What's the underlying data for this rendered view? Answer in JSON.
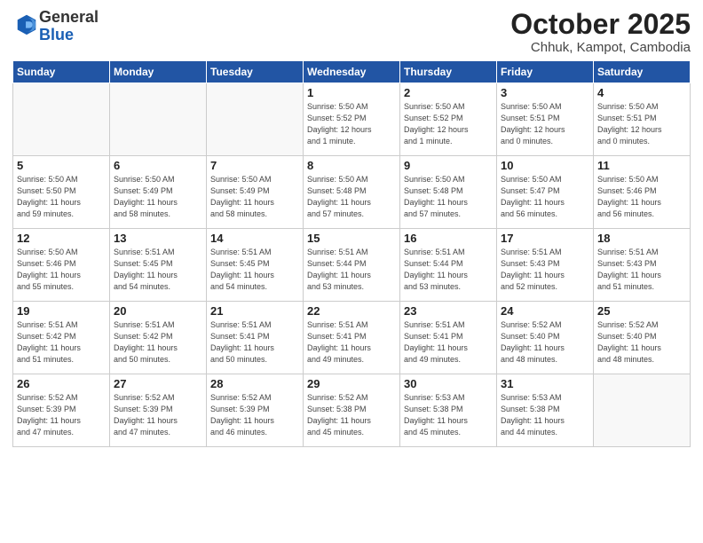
{
  "header": {
    "logo_general": "General",
    "logo_blue": "Blue",
    "month": "October 2025",
    "location": "Chhuk, Kampot, Cambodia"
  },
  "weekdays": [
    "Sunday",
    "Monday",
    "Tuesday",
    "Wednesday",
    "Thursday",
    "Friday",
    "Saturday"
  ],
  "weeks": [
    [
      {
        "day": "",
        "info": ""
      },
      {
        "day": "",
        "info": ""
      },
      {
        "day": "",
        "info": ""
      },
      {
        "day": "1",
        "info": "Sunrise: 5:50 AM\nSunset: 5:52 PM\nDaylight: 12 hours\nand 1 minute."
      },
      {
        "day": "2",
        "info": "Sunrise: 5:50 AM\nSunset: 5:52 PM\nDaylight: 12 hours\nand 1 minute."
      },
      {
        "day": "3",
        "info": "Sunrise: 5:50 AM\nSunset: 5:51 PM\nDaylight: 12 hours\nand 0 minutes."
      },
      {
        "day": "4",
        "info": "Sunrise: 5:50 AM\nSunset: 5:51 PM\nDaylight: 12 hours\nand 0 minutes."
      }
    ],
    [
      {
        "day": "5",
        "info": "Sunrise: 5:50 AM\nSunset: 5:50 PM\nDaylight: 11 hours\nand 59 minutes."
      },
      {
        "day": "6",
        "info": "Sunrise: 5:50 AM\nSunset: 5:49 PM\nDaylight: 11 hours\nand 58 minutes."
      },
      {
        "day": "7",
        "info": "Sunrise: 5:50 AM\nSunset: 5:49 PM\nDaylight: 11 hours\nand 58 minutes."
      },
      {
        "day": "8",
        "info": "Sunrise: 5:50 AM\nSunset: 5:48 PM\nDaylight: 11 hours\nand 57 minutes."
      },
      {
        "day": "9",
        "info": "Sunrise: 5:50 AM\nSunset: 5:48 PM\nDaylight: 11 hours\nand 57 minutes."
      },
      {
        "day": "10",
        "info": "Sunrise: 5:50 AM\nSunset: 5:47 PM\nDaylight: 11 hours\nand 56 minutes."
      },
      {
        "day": "11",
        "info": "Sunrise: 5:50 AM\nSunset: 5:46 PM\nDaylight: 11 hours\nand 56 minutes."
      }
    ],
    [
      {
        "day": "12",
        "info": "Sunrise: 5:50 AM\nSunset: 5:46 PM\nDaylight: 11 hours\nand 55 minutes."
      },
      {
        "day": "13",
        "info": "Sunrise: 5:51 AM\nSunset: 5:45 PM\nDaylight: 11 hours\nand 54 minutes."
      },
      {
        "day": "14",
        "info": "Sunrise: 5:51 AM\nSunset: 5:45 PM\nDaylight: 11 hours\nand 54 minutes."
      },
      {
        "day": "15",
        "info": "Sunrise: 5:51 AM\nSunset: 5:44 PM\nDaylight: 11 hours\nand 53 minutes."
      },
      {
        "day": "16",
        "info": "Sunrise: 5:51 AM\nSunset: 5:44 PM\nDaylight: 11 hours\nand 53 minutes."
      },
      {
        "day": "17",
        "info": "Sunrise: 5:51 AM\nSunset: 5:43 PM\nDaylight: 11 hours\nand 52 minutes."
      },
      {
        "day": "18",
        "info": "Sunrise: 5:51 AM\nSunset: 5:43 PM\nDaylight: 11 hours\nand 51 minutes."
      }
    ],
    [
      {
        "day": "19",
        "info": "Sunrise: 5:51 AM\nSunset: 5:42 PM\nDaylight: 11 hours\nand 51 minutes."
      },
      {
        "day": "20",
        "info": "Sunrise: 5:51 AM\nSunset: 5:42 PM\nDaylight: 11 hours\nand 50 minutes."
      },
      {
        "day": "21",
        "info": "Sunrise: 5:51 AM\nSunset: 5:41 PM\nDaylight: 11 hours\nand 50 minutes."
      },
      {
        "day": "22",
        "info": "Sunrise: 5:51 AM\nSunset: 5:41 PM\nDaylight: 11 hours\nand 49 minutes."
      },
      {
        "day": "23",
        "info": "Sunrise: 5:51 AM\nSunset: 5:41 PM\nDaylight: 11 hours\nand 49 minutes."
      },
      {
        "day": "24",
        "info": "Sunrise: 5:52 AM\nSunset: 5:40 PM\nDaylight: 11 hours\nand 48 minutes."
      },
      {
        "day": "25",
        "info": "Sunrise: 5:52 AM\nSunset: 5:40 PM\nDaylight: 11 hours\nand 48 minutes."
      }
    ],
    [
      {
        "day": "26",
        "info": "Sunrise: 5:52 AM\nSunset: 5:39 PM\nDaylight: 11 hours\nand 47 minutes."
      },
      {
        "day": "27",
        "info": "Sunrise: 5:52 AM\nSunset: 5:39 PM\nDaylight: 11 hours\nand 47 minutes."
      },
      {
        "day": "28",
        "info": "Sunrise: 5:52 AM\nSunset: 5:39 PM\nDaylight: 11 hours\nand 46 minutes."
      },
      {
        "day": "29",
        "info": "Sunrise: 5:52 AM\nSunset: 5:38 PM\nDaylight: 11 hours\nand 45 minutes."
      },
      {
        "day": "30",
        "info": "Sunrise: 5:53 AM\nSunset: 5:38 PM\nDaylight: 11 hours\nand 45 minutes."
      },
      {
        "day": "31",
        "info": "Sunrise: 5:53 AM\nSunset: 5:38 PM\nDaylight: 11 hours\nand 44 minutes."
      },
      {
        "day": "",
        "info": ""
      }
    ]
  ]
}
